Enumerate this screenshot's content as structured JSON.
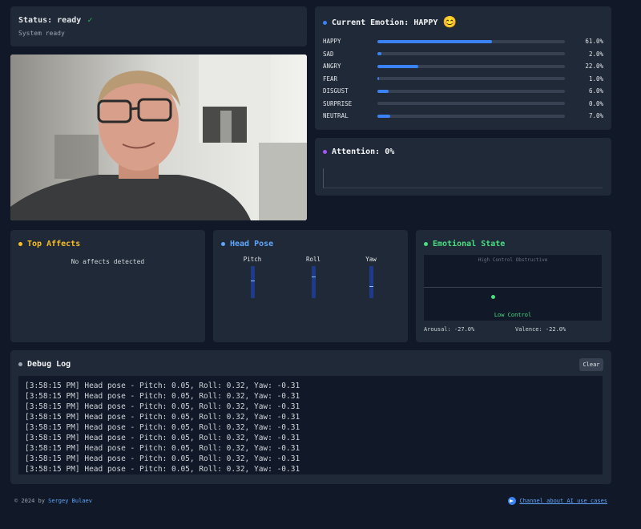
{
  "colors": {
    "background": "#111827",
    "card": "#1f2937",
    "accent_blue": "#3b82f6",
    "accent_yellow": "#fbbf24",
    "accent_green": "#4ade80",
    "accent_purple": "#a855f7"
  },
  "status": {
    "label": "Status: ready",
    "check_icon": "✓",
    "message": "System ready"
  },
  "video": {
    "icon": "webcam-feed"
  },
  "emotions": {
    "title": "Current Emotion: HAPPY",
    "emoji": "😊",
    "items": [
      {
        "label": "HAPPY",
        "percent_text": "61.0%",
        "value": 61.0
      },
      {
        "label": "SAD",
        "percent_text": "2.0%",
        "value": 2.0
      },
      {
        "label": "ANGRY",
        "percent_text": "22.0%",
        "value": 22.0
      },
      {
        "label": "FEAR",
        "percent_text": "1.0%",
        "value": 1.0
      },
      {
        "label": "DISGUST",
        "percent_text": "6.0%",
        "value": 6.0
      },
      {
        "label": "SURPRISE",
        "percent_text": "0.0%",
        "value": 0.0
      },
      {
        "label": "NEUTRAL",
        "percent_text": "7.0%",
        "value": 7.0
      }
    ]
  },
  "attention": {
    "title": "Attention: 0%",
    "value": 0
  },
  "affects": {
    "title": "Top Affects",
    "empty_message": "No affects detected"
  },
  "head_pose": {
    "title": "Head Pose",
    "axes": [
      {
        "label": "Pitch",
        "value": 0.05
      },
      {
        "label": "Roll",
        "value": 0.32
      },
      {
        "label": "Yaw",
        "value": -0.31
      }
    ]
  },
  "emotional_state": {
    "title": "Emotional State",
    "top_label": "High Control  Obstructive",
    "bottom_label": "Low Control",
    "arousal_text": "Arousal: -27.0%",
    "valence_text": "Valence: -22.0%",
    "arousal": -27.0,
    "valence": -22.0
  },
  "debug": {
    "title": "Debug Log",
    "clear_label": "Clear",
    "lines": [
      "[3:58:15 PM] Head pose - Pitch: 0.05, Roll: 0.32, Yaw: -0.31",
      "[3:58:15 PM] Head pose - Pitch: 0.05, Roll: 0.32, Yaw: -0.31",
      "[3:58:15 PM] Head pose - Pitch: 0.05, Roll: 0.32, Yaw: -0.31",
      "[3:58:15 PM] Head pose - Pitch: 0.05, Roll: 0.32, Yaw: -0.31",
      "[3:58:15 PM] Head pose - Pitch: 0.05, Roll: 0.32, Yaw: -0.31",
      "[3:58:15 PM] Head pose - Pitch: 0.05, Roll: 0.32, Yaw: -0.31",
      "[3:58:15 PM] Head pose - Pitch: 0.05, Roll: 0.32, Yaw: -0.31",
      "[3:58:15 PM] Head pose - Pitch: 0.05, Roll: 0.32, Yaw: -0.31",
      "[3:58:15 PM] Head pose - Pitch: 0.05, Roll: 0.32, Yaw: -0.31"
    ]
  },
  "footer": {
    "copyright": "© 2024 by",
    "author": "Sergey Bulaev",
    "channel_label": "Channel about AI use cases",
    "channel_icon": "telegram-icon"
  }
}
